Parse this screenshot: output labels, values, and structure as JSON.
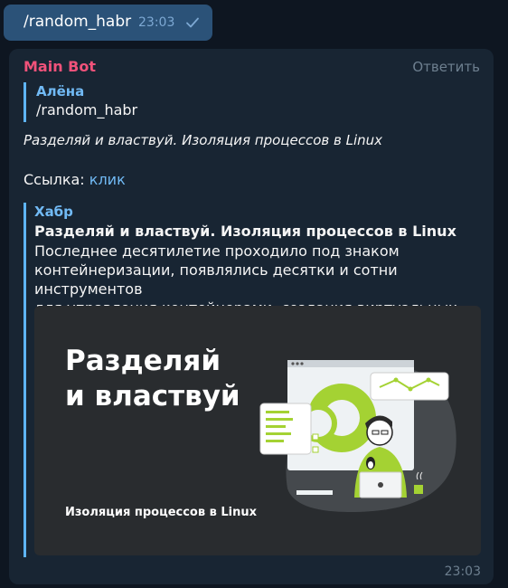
{
  "outgoing": {
    "text": "/random_habr",
    "time": "23:03",
    "status_icon": "check-icon"
  },
  "incoming": {
    "sender": "Main Bot",
    "reply_button": "Ответить",
    "quote": {
      "author": "Алёна",
      "text": "/random_habr"
    },
    "italic_title": "Разделяй и властвуй. Изоляция процессов в Linux",
    "link_prefix": "Ссылка: ",
    "link_text": "клик",
    "preview": {
      "site": "Хабр",
      "title": "Разделяй и властвуй. Изоляция процессов в Linux",
      "description": "Последнее десятилетие проходило под знаком\nконтейнеризации, появлялись десятки и сотни инструментов\nдля управления контейнерами, создания виртуальных сетей ...",
      "image_title": "Разделяй\nи властвуй",
      "image_subtitle": "Изоляция процессов в Linux"
    },
    "time": "23:03"
  },
  "colors": {
    "background": "#0e1621",
    "outgoing_bubble": "#2b5278",
    "incoming_bubble": "#182533",
    "sender": "#f0527a",
    "accent": "#71baf5",
    "lime": "#a4d233"
  }
}
